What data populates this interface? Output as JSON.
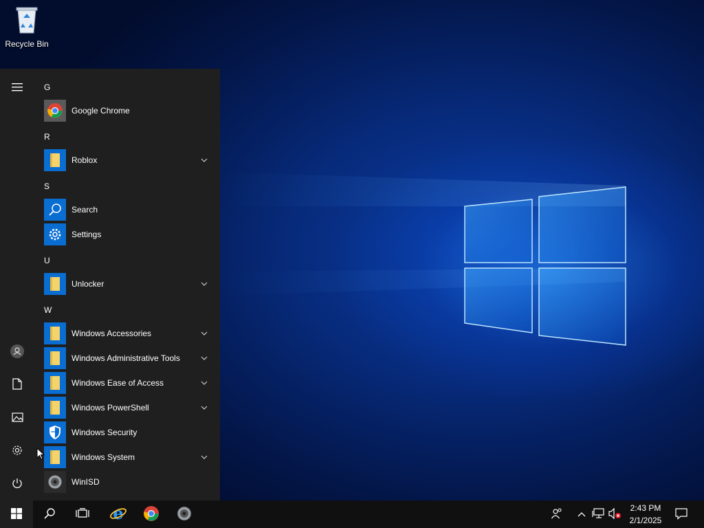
{
  "desktop": {
    "icons": [
      {
        "label": "Recycle Bin",
        "icon": "recycle-bin-icon"
      }
    ]
  },
  "start_menu": {
    "rail": [
      {
        "icon": "hamburger-menu-icon"
      },
      {
        "icon": "user-avatar-icon"
      },
      {
        "icon": "documents-icon"
      },
      {
        "icon": "pictures-icon"
      },
      {
        "icon": "settings-gear-icon"
      },
      {
        "icon": "power-icon"
      }
    ],
    "groups": [
      {
        "letter": "G",
        "apps": [
          {
            "name": "Google Chrome",
            "icon": "chrome-icon",
            "expandable": false
          }
        ]
      },
      {
        "letter": "R",
        "apps": [
          {
            "name": "Roblox",
            "icon": "folder-icon",
            "expandable": true
          }
        ]
      },
      {
        "letter": "S",
        "apps": [
          {
            "name": "Search",
            "icon": "search-icon",
            "expandable": false
          },
          {
            "name": "Settings",
            "icon": "gear-icon",
            "expandable": false
          }
        ]
      },
      {
        "letter": "U",
        "apps": [
          {
            "name": "Unlocker",
            "icon": "folder-icon",
            "expandable": true
          }
        ]
      },
      {
        "letter": "W",
        "apps": [
          {
            "name": "Windows Accessories",
            "icon": "folder-icon",
            "expandable": true
          },
          {
            "name": "Windows Administrative Tools",
            "icon": "folder-icon",
            "expandable": true
          },
          {
            "name": "Windows Ease of Access",
            "icon": "folder-icon",
            "expandable": true
          },
          {
            "name": "Windows PowerShell",
            "icon": "folder-icon",
            "expandable": true
          },
          {
            "name": "Windows Security",
            "icon": "shield-icon",
            "expandable": false
          },
          {
            "name": "Windows System",
            "icon": "folder-icon",
            "expandable": true
          },
          {
            "name": "WinISD",
            "icon": "speaker-icon",
            "expandable": false
          }
        ]
      }
    ]
  },
  "taskbar": {
    "pinned": [
      {
        "icon": "windows-start-icon"
      },
      {
        "icon": "search-icon"
      },
      {
        "icon": "task-view-icon"
      },
      {
        "icon": "internet-explorer-icon"
      },
      {
        "icon": "chrome-icon"
      },
      {
        "icon": "speaker-icon"
      }
    ],
    "tray": [
      {
        "icon": "people-icon"
      },
      {
        "icon": "chevron-up-icon"
      },
      {
        "icon": "network-icon"
      },
      {
        "icon": "volume-muted-icon"
      }
    ],
    "clock": {
      "time": "2:43 PM",
      "date": "2/1/2025"
    },
    "notification_icon": "action-center-icon"
  },
  "colors": {
    "accent": "#0a6dd1",
    "menu_bg": "#1f1f1f",
    "taskbar_bg": "#101010",
    "folder": "#f5d36b"
  }
}
